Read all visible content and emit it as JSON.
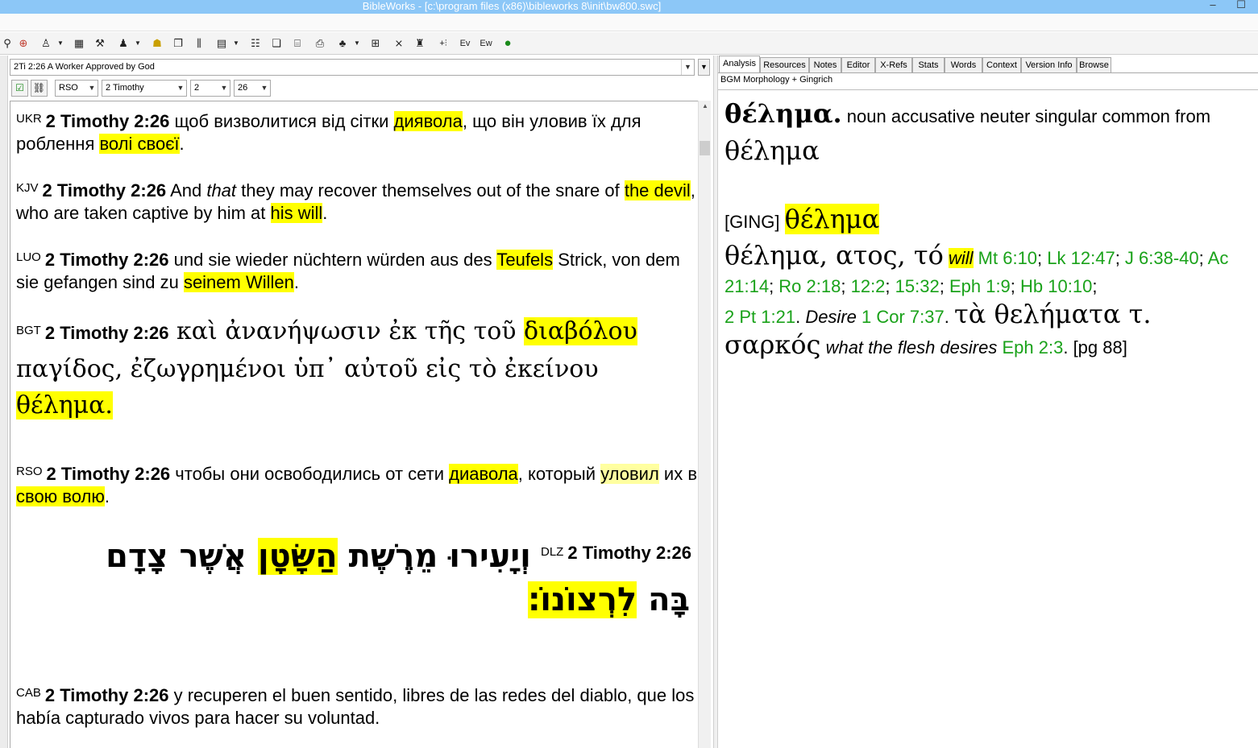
{
  "window": {
    "title": "BibleWorks - [c:\\program files (x86)\\bibleworks 8\\init\\bw800.swc]"
  },
  "colors": {
    "highlight": "#ffff00",
    "ref_green": "#1aa21a",
    "titlebar": "#8cc7f7"
  },
  "toolbar": {
    "icons": [
      "search-icon",
      "crosshair-icon",
      "person-icon",
      "calendar-icon",
      "tools-icon",
      "user-icon",
      "lamp-icon",
      "windows-icon",
      "columns-icon",
      "grid-icon",
      "list-icon",
      "copy-icon",
      "folder-icon",
      "printer-icon",
      "tree-icon",
      "layout-icon",
      "bookmark-icon",
      "plus-icon",
      "ev-icon",
      "ew-icon",
      "globe-icon"
    ]
  },
  "left": {
    "verse_select": "2Ti 2:26 A Worker Approved by God",
    "version": "RSO",
    "book": "2 Timothy",
    "chapter": "2",
    "verse": "26"
  },
  "verses": {
    "ukr": {
      "ver": "UKR",
      "ref": "2 Timothy 2:26",
      "t1": " щоб визволитися від сітки ",
      "h1": "диявола",
      "t2": ", що він уловив їх для роблення ",
      "h2": "волі своєї",
      "t3": "."
    },
    "kjv": {
      "ver": "KJV",
      "ref": "2 Timothy 2:26",
      "t1": " And ",
      "i1": "that",
      "t2": " they may recover themselves out of the snare of ",
      "h1": "the devil",
      "t3": ", who are taken captive by him at ",
      "h2": "his will",
      "t4": "."
    },
    "luo": {
      "ver": "LUO",
      "ref": "2 Timothy 2:26",
      "t1": " und sie wieder nüchtern würden aus des ",
      "h1": "Teufels",
      "t2": " Strick, von dem sie gefangen sind zu ",
      "h2": "seinem Willen",
      "t3": "."
    },
    "bgt": {
      "ver": "BGT",
      "ref": "2 Timothy 2:26",
      "t1": " καὶ ἀνανήψωσιν ἐκ τῆς τοῦ ",
      "h1": "διαβόλου",
      "t2": " παγίδος, ἐζωγρημένοι ὑπ᾽ αὐτοῦ εἰς τὸ ἐκείνου ",
      "h2": "θέλημα",
      "t3": "."
    },
    "rso": {
      "ver": "RSO",
      "ref": "2 Timothy 2:26",
      "t1": " чтобы они освободились от сети ",
      "h1": "диавола",
      "t2": ", который ",
      "h3": "уловил",
      "t3": " их в ",
      "h2": "свою волю",
      "t4": "."
    },
    "dlz": {
      "ver": "DLZ",
      "ref": "2 Timothy 2:26",
      "t1": "וְיָעִירוּ מֵרֶשֶׁת ",
      "h1": "הַשָּׂטָן",
      "t2": " אֲשֶׁר צָדָם",
      "t3": "בָּה ",
      "h2": "לִרְצוֹנוֹ׃"
    },
    "cab": {
      "ver": "CAB",
      "ref": "2 Timothy 2:26",
      "t1": " y recuperen el buen sentido, libres de las redes del diablo, que los había capturado vivos para hacer su voluntad."
    }
  },
  "right": {
    "tabs": [
      "Analysis",
      "Resources",
      "Notes",
      "Editor",
      "X-Refs",
      "Stats",
      "Words",
      "Context",
      "Version Info",
      "Browse"
    ],
    "active_tab": "Analysis",
    "panel_title": "BGM Morphology + Gingrich",
    "morph": {
      "word": "θέλημα.",
      "desc": " noun accusative neuter singular common from",
      "lemma": "θέλημα"
    },
    "ging": {
      "label": "[GING]",
      "headword": "θέλημα",
      "forms": "θέλημα, ατος, τό",
      "gloss1": "will",
      "refs1": [
        "Mt 6:10",
        "Lk 12:47",
        "J 6:38-40",
        "Ac 21:14",
        "Ro 2:18",
        "12:2",
        "15:32",
        "Eph 1:9",
        "Hb 10:10",
        "2 Pt 1:21"
      ],
      "gloss2": "Desire",
      "ref2": "1 Cor 7:37",
      "phrase": "τὰ θελήματα τ. σαρκός",
      "gloss3": "what the flesh desires",
      "ref3": "Eph 2:3",
      "page": "[pg 88]"
    }
  }
}
